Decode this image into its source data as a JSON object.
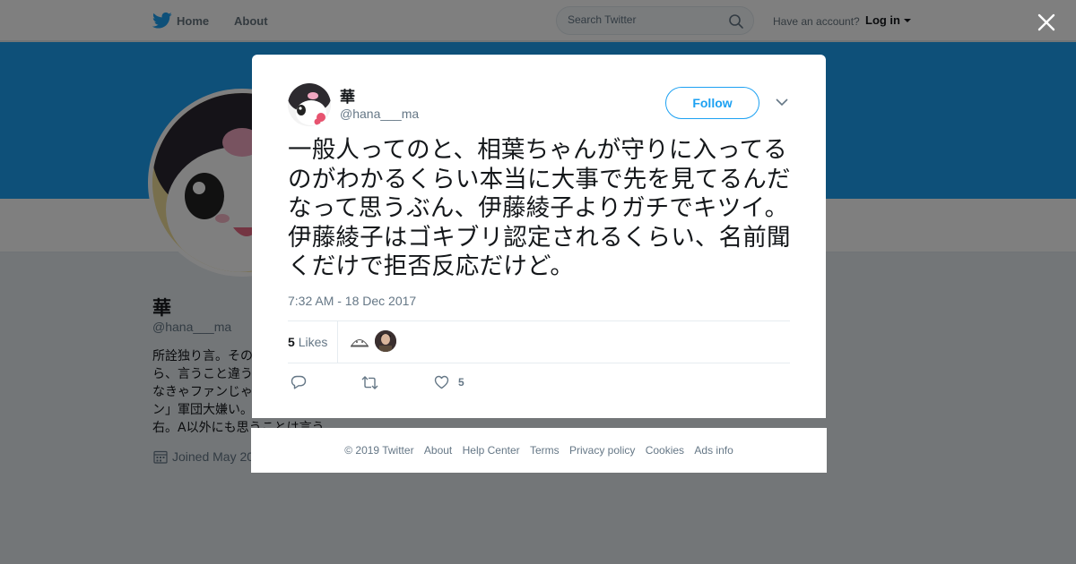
{
  "nav": {
    "home_label": "Home",
    "about_label": "About",
    "search_placeholder": "Search Twitter",
    "account_question": "Have an account?",
    "login_label": "Log in"
  },
  "profile": {
    "name": "華",
    "handle": "@hana___ma",
    "bio_lines": [
      "所詮独り言。その",
      "ら、言うこと違う",
      "なきゃファンじゃ",
      "ン」軍団大嫌い。",
      "右。A以外にも思うことは言う。"
    ],
    "joined": "Joined May 20"
  },
  "tweet": {
    "author_name": "華",
    "author_handle": "@hana___ma",
    "follow_label": "Follow",
    "text": "一般人ってのと、相葉ちゃんが守りに入ってるのがわかるくらい本当に大事で先を見てるんだなって思うぶん、伊藤綾子よりガチでキツイ。伊藤綾子はゴキブリ認定されるくらい、名前聞くだけで拒否反応だけど。",
    "timestamp": "7:32 AM - 18 Dec 2017",
    "likes_count": "5",
    "likes_label": "Likes",
    "action_like_count": "5"
  },
  "footer": {
    "copyright": "© 2019 Twitter",
    "about": "About",
    "help": "Help Center",
    "terms": "Terms",
    "privacy": "Privacy policy",
    "cookies": "Cookies",
    "ads": "Ads info"
  },
  "colors": {
    "brand": "#1da1f2",
    "text_primary": "#14171a",
    "text_secondary": "#657786",
    "page_bg": "#e6ecf0",
    "overlay": "rgba(0,0,0,0.5)"
  },
  "icons": [
    "twitter-bird-icon",
    "search-icon",
    "caret-down-icon",
    "close-icon",
    "chevron-down-icon",
    "calendar-icon",
    "reply-icon",
    "retweet-icon",
    "heart-icon"
  ]
}
